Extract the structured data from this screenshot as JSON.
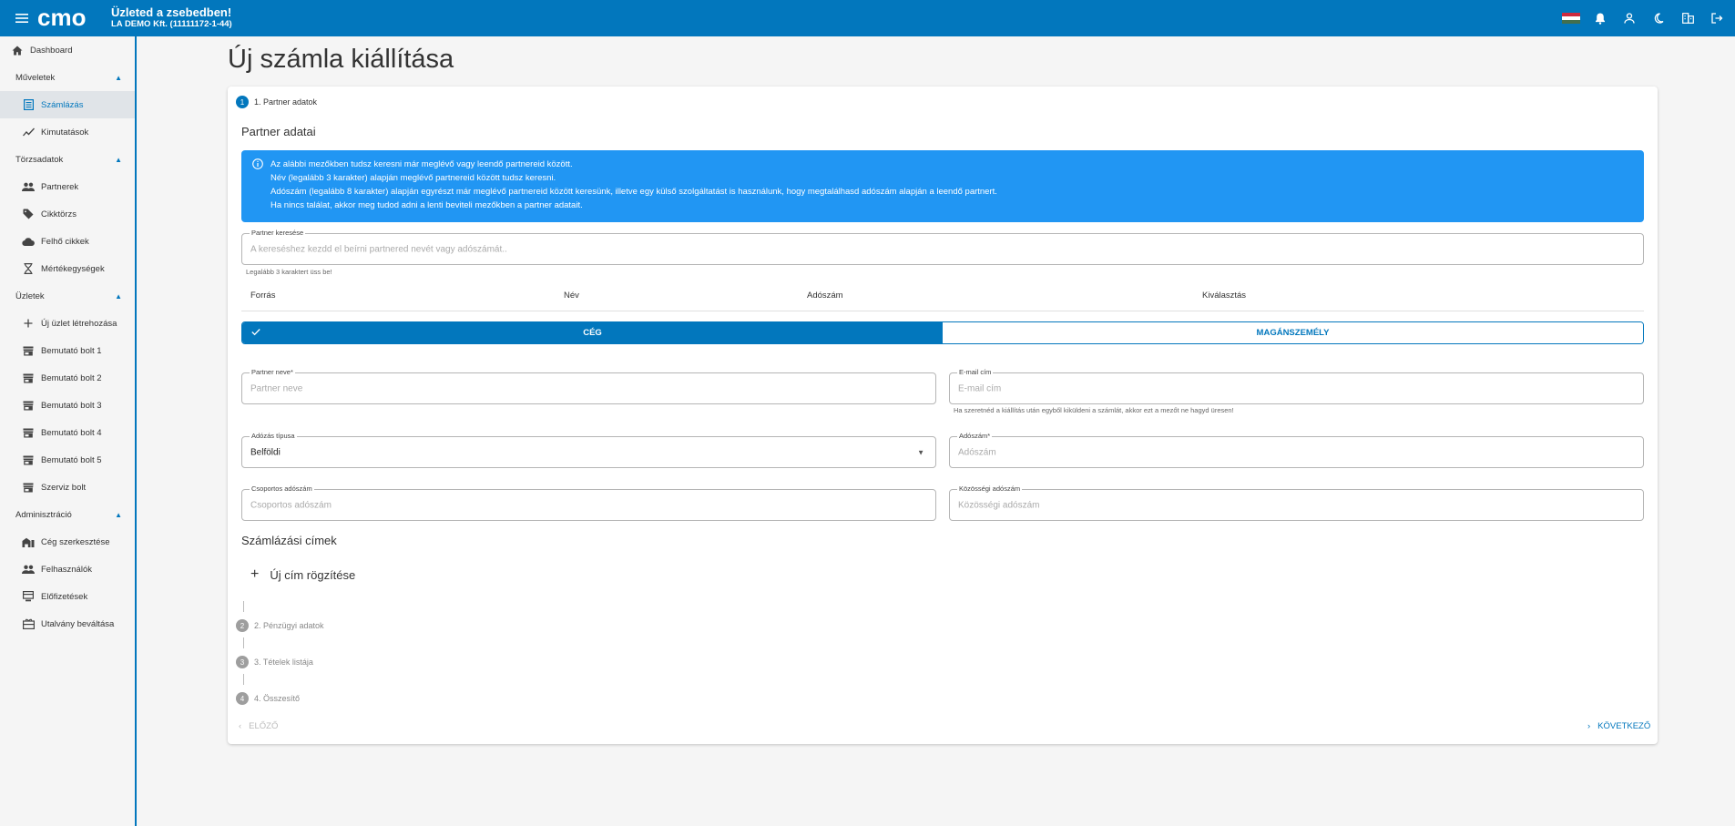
{
  "topbar": {
    "logo_text": "cmo",
    "title": "Üzleted a zsebedben!",
    "subtitle": "LA DEMO Kft. (11111172-1-44)",
    "icons": [
      "flag-hu-icon",
      "bell-icon",
      "account-icon",
      "dark-mode-icon",
      "company-icon",
      "logout-icon"
    ]
  },
  "sidebar": {
    "dashboard": "Dashboard",
    "groups": [
      {
        "label": "Műveletek",
        "items": [
          "Számlázás",
          "Kimutatások"
        ]
      },
      {
        "label": "Törzsadatok",
        "items": [
          "Partnerek",
          "Cikktörzs",
          "Felhő cikkek",
          "Mértékegységek"
        ]
      },
      {
        "label": "Üzletek",
        "items": [
          "Új üzlet létrehozása",
          "Bemutató bolt 1",
          "Bemutató bolt 2",
          "Bemutató bolt 3",
          "Bemutató bolt 4",
          "Bemutató bolt 5",
          "Szerviz bolt"
        ]
      },
      {
        "label": "Adminisztráció",
        "items": [
          "Cég szerkesztése",
          "Felhasználók",
          "Előfizetések",
          "Utalvány beváltása"
        ]
      }
    ]
  },
  "page": {
    "title": "Új számla kiállítása",
    "steps": [
      {
        "num": "1",
        "label": "1. Partner adatok"
      },
      {
        "num": "2",
        "label": "2. Pénzügyi adatok"
      },
      {
        "num": "3",
        "label": "3. Tételek listája"
      },
      {
        "num": "4",
        "label": "4. Összesítő"
      }
    ],
    "section_partner": "Partner adatai",
    "alert_lines": [
      "Az alábbi mezőkben tudsz keresni már meglévő vagy leendő partnereid között.",
      "Név (legalább 3 karakter) alapján meglévő partnereid között tudsz keresni.",
      "Adószám (legalább 8 karakter) alapján egyrészt már meglévő partnereid között keresünk, illetve egy külső szolgáltatást is használunk, hogy megtalálhasd adószám alapján a leendő partnert.",
      "Ha nincs találat, akkor meg tudod adni a lenti beviteli mezőkben a partner adatait."
    ],
    "search": {
      "label": "Partner keresése",
      "placeholder": "A kereséshez kezdd el beírni partnered nevét vagy adószámát..",
      "hint": "Legalább 3 karaktert üss be!"
    },
    "table_headers": [
      "Forrás",
      "Név",
      "Adószám",
      "Kiválasztás"
    ],
    "toggle": {
      "company": "CÉG",
      "private": "MAGÁNSZEMÉLY",
      "selected": "company"
    },
    "fields": {
      "partner_name": {
        "label": "Partner neve*",
        "placeholder": "Partner neve"
      },
      "email": {
        "label": "E-mail cím",
        "placeholder": "E-mail cím",
        "hint": "Ha szeretnéd a kiállítás után egyből kiküldeni a számlát, akkor ezt a mezőt ne hagyd üresen!"
      },
      "tax_type": {
        "label": "Adózás típusa",
        "value": "Belföldi"
      },
      "tax_number": {
        "label": "Adószám*",
        "placeholder": "Adószám"
      },
      "group_tax": {
        "label": "Csoportos adószám",
        "placeholder": "Csoportos adószám"
      },
      "community_tax": {
        "label": "Közösségi adószám",
        "placeholder": "Közösségi adószám"
      }
    },
    "section_addresses": "Számlázási címek",
    "add_address": "Új cím rögzítése",
    "nav": {
      "prev": "ELŐZŐ",
      "next": "KÖVETKEZŐ"
    }
  },
  "colors": {
    "primary": "#0277bd",
    "alert": "#2196f3",
    "inactive": "#9e9e9e"
  }
}
